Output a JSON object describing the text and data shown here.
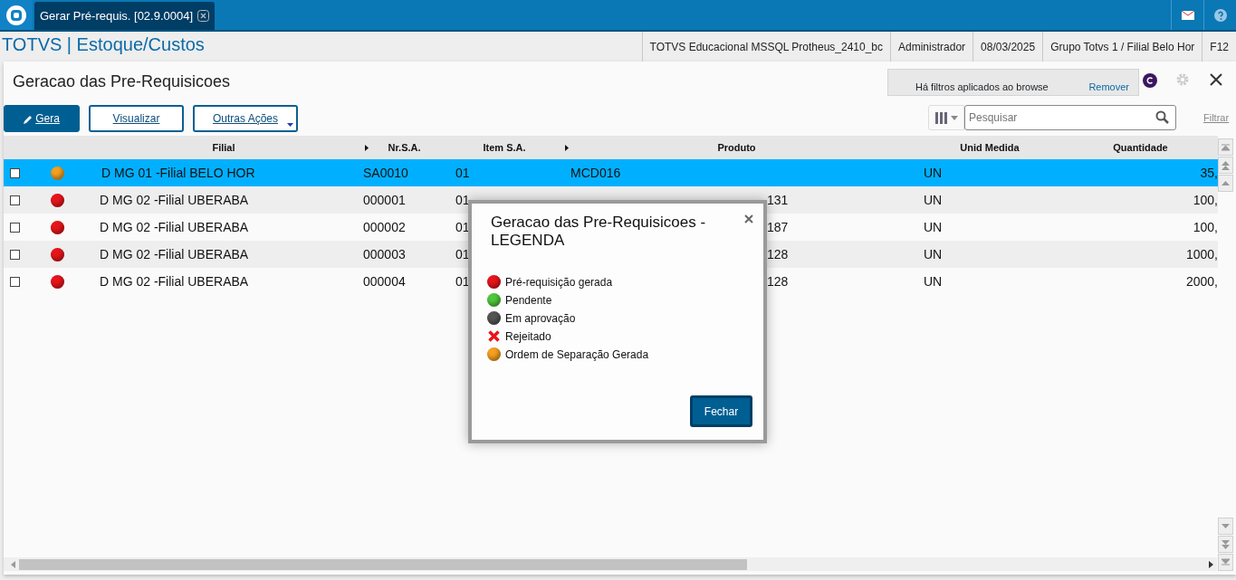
{
  "tab": {
    "title": "Gerar Pré-requis. [02.9.0004]"
  },
  "module_title": "TOTVS | Estoque/Custos",
  "header_info": [
    "TOTVS Educacional MSSQL Protheus_2410_bc",
    "Administrador",
    "08/03/2025",
    "Grupo Totvs 1 / Filial Belo Hor",
    "F12"
  ],
  "page_title": "Geracao das Pre-Requisicoes",
  "filter_notice": {
    "text": "Há filtros aplicados ao browse",
    "action": "Remover"
  },
  "actions": [
    {
      "label": "Gera",
      "kind": "primary"
    },
    {
      "label": "Visualizar",
      "kind": "outline"
    },
    {
      "label": "Outras Ações",
      "kind": "dropdown"
    }
  ],
  "search": {
    "placeholder": "Pesquisar",
    "filter_link": "Filtrar"
  },
  "table": {
    "columns": [
      "Filial",
      "Nr.S.A.",
      "Item S.A.",
      "Produto",
      "Unid Medida",
      "Quantidade"
    ],
    "rows": [
      {
        "selected": true,
        "checked": false,
        "color": "#f5a020",
        "filial": "D MG 01 -Filial BELO HOR",
        "nr": "SA0010",
        "item": "01",
        "produto": "MCD016",
        "kind": "plain",
        "unid": "UN",
        "quantidade": "35,"
      },
      {
        "selected": false,
        "checked": false,
        "color": "#e8151b",
        "filial": "D MG 02 -Filial UBERABA",
        "nr": "000001",
        "item": "01",
        "produto": "131",
        "kind": "under_dialog",
        "unid": "UN",
        "quantidade": "100,"
      },
      {
        "selected": false,
        "checked": false,
        "color": "#e8151b",
        "filial": "D MG 02 -Filial UBERABA",
        "nr": "000002",
        "item": "01",
        "produto": "187",
        "kind": "under_dialog",
        "unid": "UN",
        "quantidade": "100,"
      },
      {
        "selected": false,
        "checked": false,
        "color": "#e8151b",
        "filial": "D MG 02 -Filial UBERABA",
        "nr": "000003",
        "item": "01",
        "produto": "128",
        "kind": "under_dialog",
        "unid": "UN",
        "quantidade": "1000,"
      },
      {
        "selected": false,
        "checked": false,
        "color": "#e8151b",
        "filial": "D MG 02 -Filial UBERABA",
        "nr": "000004",
        "item": "01",
        "produto": "128",
        "kind": "under_dialog",
        "unid": "UN",
        "quantidade": "2000,"
      }
    ]
  },
  "dialog": {
    "title": "Geracao das Pre-Requisicoes - LEGENDA",
    "items": [
      {
        "kind": "ball",
        "color": "#e8151b",
        "label": "Pré-requisição gerada"
      },
      {
        "kind": "ball",
        "color": "#4fc83c",
        "label": "Pendente"
      },
      {
        "kind": "ball",
        "color": "#555555",
        "label": "Em aprovação"
      },
      {
        "kind": "cross",
        "color": "#e8151b",
        "label": "Rejeitado"
      },
      {
        "kind": "ball",
        "color": "#f5a020",
        "label": "Ordem de Separação Gerada"
      }
    ],
    "button": "Fechar"
  }
}
